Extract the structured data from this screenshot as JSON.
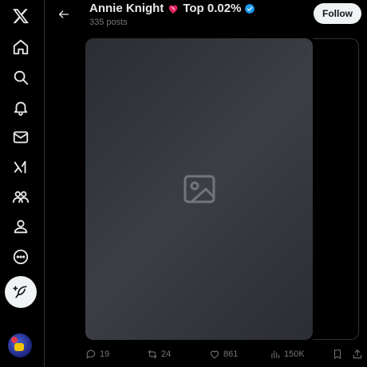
{
  "sidebar": {
    "items": [
      {
        "icon": "x-logo-icon"
      },
      {
        "icon": "home-icon"
      },
      {
        "icon": "search-icon"
      },
      {
        "icon": "bell-icon"
      },
      {
        "icon": "mail-icon"
      },
      {
        "icon": "grok-icon"
      },
      {
        "icon": "communities-icon"
      },
      {
        "icon": "profile-icon"
      },
      {
        "icon": "more-icon"
      }
    ],
    "compose_icon": "feather-plus-icon"
  },
  "header": {
    "name": "Annie Knight",
    "name_suffix": "Top 0.02%",
    "post_count": "335 posts",
    "follow_label": "Follow",
    "verified_color": "#1d9bf0"
  },
  "media": {
    "alt_state": "placeholder"
  },
  "actions": {
    "replies": "19",
    "reposts": "24",
    "likes": "861",
    "views": "150K"
  },
  "colors": {
    "background": "#000000",
    "text": "#e7e9ea",
    "muted": "#71767b",
    "follow_bg": "#eff3f4"
  }
}
